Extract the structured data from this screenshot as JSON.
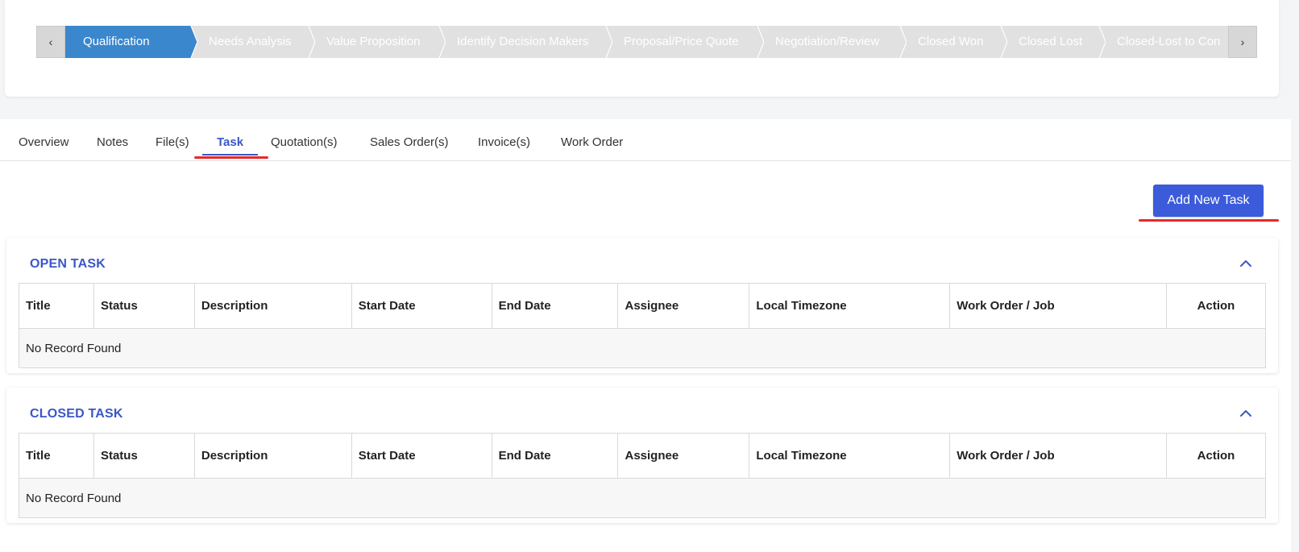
{
  "stagebar": {
    "prev_icon": "chevron-left-icon",
    "next_icon": "chevron-right-icon",
    "stages": [
      {
        "label": "Qualification",
        "active": true
      },
      {
        "label": "Needs Analysis",
        "active": false
      },
      {
        "label": "Value Proposition",
        "active": false
      },
      {
        "label": "Identify Decision Makers",
        "active": false
      },
      {
        "label": "Proposal/Price Quote",
        "active": false
      },
      {
        "label": "Negotiation/Review",
        "active": false
      },
      {
        "label": "Closed Won",
        "active": false
      },
      {
        "label": "Closed Lost",
        "active": false
      },
      {
        "label": "Closed-Lost to Con",
        "active": false
      }
    ]
  },
  "tabs": [
    {
      "label": "Overview",
      "active": false
    },
    {
      "label": "Notes",
      "active": false
    },
    {
      "label": "File(s)",
      "active": false
    },
    {
      "label": "Task",
      "active": true
    },
    {
      "label": "Quotation(s)",
      "active": false
    },
    {
      "label": "Sales Order(s)",
      "active": false
    },
    {
      "label": "Invoice(s)",
      "active": false
    },
    {
      "label": "Work Order",
      "active": false
    }
  ],
  "add_button_label": "Add New Task",
  "columns": [
    "Title",
    "Status",
    "Description",
    "Start Date",
    "End Date",
    "Assignee",
    "Local Timezone",
    "Work Order / Job",
    "Action"
  ],
  "open_panel": {
    "title": "OPEN TASK",
    "empty_text": "No Record Found"
  },
  "closed_panel": {
    "title": "CLOSED TASK",
    "empty_text": "No Record Found"
  },
  "colors": {
    "accent": "#3a57c9",
    "active_stage": "#3b87cd",
    "button": "#3b5bdb",
    "highlight": "#e52a2a"
  }
}
